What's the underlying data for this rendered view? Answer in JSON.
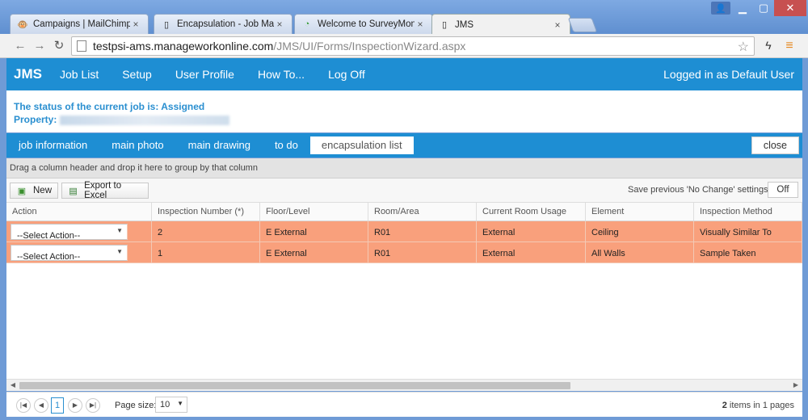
{
  "browser": {
    "tabs": [
      {
        "title": "Campaigns | MailChimp"
      },
      {
        "title": "Encapsulation - Job Mana"
      },
      {
        "title": "Welcome to SurveyMonke"
      },
      {
        "title": "JMS"
      }
    ],
    "url_host": "testpsi-ams.manageworkonline.com",
    "url_path": "/JMS/UI/Forms/InspectionWizard.aspx"
  },
  "app": {
    "brand": "JMS",
    "nav": [
      "Job List",
      "Setup",
      "User Profile",
      "How To...",
      "Log Off"
    ],
    "logged_in": "Logged in as Default User"
  },
  "status": {
    "job_status": "The status of the current job is: Assigned",
    "property_label": "Property:"
  },
  "subtabs": [
    "job information",
    "main photo",
    "main drawing",
    "to do",
    "encapsulation list"
  ],
  "close_label": "close",
  "group_hint": "Drag a column header and drop it here to group by that column",
  "grid_toolbar": {
    "new_label": "New",
    "export_label": "Export to Excel",
    "save_label": "Save previous 'No Change' settings:",
    "off_label": "Off"
  },
  "grid": {
    "columns": [
      "Action",
      "Inspection Number (*)",
      "Floor/Level",
      "Room/Area",
      "Current Room Usage",
      "Element",
      "Inspection Method"
    ],
    "rows": [
      {
        "action": "--Select Action--",
        "inspection_number": "2",
        "floor": "E External",
        "room": "R01",
        "usage": "External",
        "element": "Ceiling",
        "method": "Visually Similar To"
      },
      {
        "action": "--Select Action--",
        "inspection_number": "1",
        "floor": "E External",
        "room": "R01",
        "usage": "External",
        "element": "All Walls",
        "method": "Sample Taken"
      }
    ],
    "row_color": "#f9a07c"
  },
  "pager": {
    "current_page": "1",
    "page_size_label": "Page size:",
    "page_size": "10",
    "items_count": "2",
    "items_text": "items in 1 pages"
  },
  "colors": {
    "accent": "#1e8ed3",
    "status_text": "#2a8fd0"
  }
}
